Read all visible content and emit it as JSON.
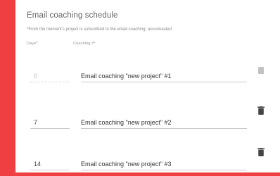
{
  "panel": {
    "title": "Email coaching schedule",
    "subtitle": "*From the moment's project is subscribed to the email coaching, accumulated"
  },
  "columns": {
    "days": "Days*",
    "coaching": "Coaching #*"
  },
  "rows": [
    {
      "days": "0",
      "coaching": "Email coaching \"new project\" #1",
      "delete_icon": "trash-icon",
      "disabled": true
    },
    {
      "days": "7",
      "coaching": "Email coaching \"new project\" #2",
      "delete_icon": "trash-icon",
      "disabled": false
    },
    {
      "days": "14",
      "coaching": "Email coaching \"new project\" #3",
      "delete_icon": "trash-icon",
      "disabled": false
    }
  ],
  "colors": {
    "background": "#ef3f43",
    "card": "#ffffff"
  }
}
